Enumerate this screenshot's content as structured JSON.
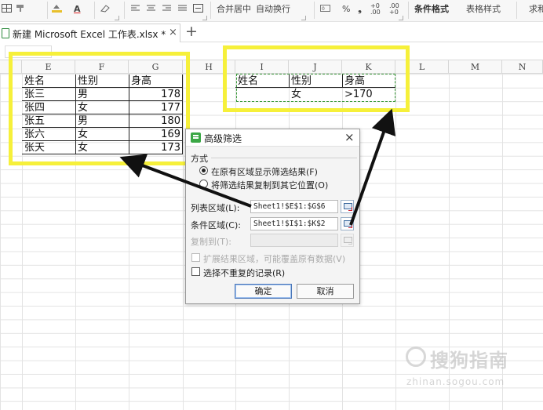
{
  "ribbon": {
    "merge_center": "合并居中",
    "wrap_text": "自动换行",
    "percent": "%",
    "cond_format": "条件格式",
    "table_style": "表格样式",
    "sum": "求和"
  },
  "tab": {
    "file_name": "新建 Microsoft Excel 工作表.xlsx *",
    "close": "×",
    "add": "+"
  },
  "columns": [
    "E",
    "F",
    "G",
    "H",
    "I",
    "J",
    "K",
    "L",
    "M",
    "N"
  ],
  "list_table": {
    "headers": [
      "姓名",
      "性别",
      "身高"
    ],
    "rows": [
      [
        "张三",
        "男",
        "178"
      ],
      [
        "张四",
        "女",
        "177"
      ],
      [
        "张五",
        "男",
        "180"
      ],
      [
        "张六",
        "女",
        "169"
      ],
      [
        "张天",
        "女",
        "173"
      ]
    ]
  },
  "criteria_table": {
    "headers": [
      "姓名",
      "性别",
      "身高"
    ],
    "row": [
      "",
      "女",
      ">170"
    ]
  },
  "dialog": {
    "title": "高级筛选",
    "close": "×",
    "mode_label": "方式",
    "option_inplace": "在原有区域显示筛选结果(F)",
    "option_copy": "将筛选结果复制到其它位置(O)",
    "list_range_label": "列表区域(L):",
    "list_range_value": "Sheet1!$E$1:$G$6",
    "criteria_range_label": "条件区域(C):",
    "criteria_range_value": "Sheet1!$I$1:$K$2",
    "copy_to_label": "复制到(T):",
    "copy_to_value": "",
    "extend_label": "扩展结果区域，可能覆盖原有数据(V)",
    "unique_label": "选择不重复的记录(R)",
    "ok": "确定",
    "cancel": "取消"
  },
  "watermark": {
    "brand": "搜狗指南",
    "url": "zhinan.sogou.com"
  },
  "colors": {
    "highlight": "#f6f03a",
    "selection_dash": "#3a9a3a",
    "arrow": "#111111"
  }
}
